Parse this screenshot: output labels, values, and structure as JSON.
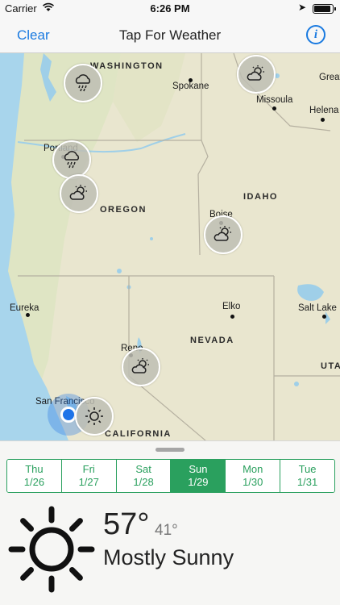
{
  "status_bar": {
    "carrier": "Carrier",
    "time": "6:26 PM"
  },
  "nav": {
    "clear_label": "Clear",
    "title": "Tap For Weather",
    "info_label": "i"
  },
  "map": {
    "cities": [
      "Spokane",
      "Missoula",
      "Helena",
      "Great",
      "Portland",
      "Boise",
      "Eureka",
      "Elko",
      "Salt Lake",
      "Reno",
      "San Francisco"
    ],
    "states": [
      "WASHINGTON",
      "OREGON",
      "IDAHO",
      "NEVADA",
      "CALIFORNIA",
      "UTA"
    ],
    "pins": [
      {
        "place": "Washington",
        "icon": "rain-cloud-icon"
      },
      {
        "place": "Montana",
        "icon": "partly-cloudy-icon"
      },
      {
        "place": "Portland",
        "icon": "rain-cloud-icon"
      },
      {
        "place": "Oregon",
        "icon": "partly-cloudy-icon"
      },
      {
        "place": "Boise",
        "icon": "partly-cloudy-icon"
      },
      {
        "place": "Reno",
        "icon": "partly-cloudy-icon"
      },
      {
        "place": "San Francisco",
        "icon": "sun-icon"
      }
    ],
    "colors": {
      "land": "#ebe8d3",
      "water": "#9fcfe8",
      "ocean": "#a8d5ec",
      "border": "#b5b0a0"
    }
  },
  "forecast": {
    "days": [
      {
        "name": "Thu",
        "date": "1/26"
      },
      {
        "name": "Fri",
        "date": "1/27"
      },
      {
        "name": "Sat",
        "date": "1/28"
      },
      {
        "name": "Sun",
        "date": "1/29"
      },
      {
        "name": "Mon",
        "date": "1/30"
      },
      {
        "name": "Tue",
        "date": "1/31"
      }
    ],
    "selected_day": "Sun",
    "high": "57°",
    "low": "41°",
    "condition": "Mostly Sunny",
    "condition_icon": "sun-icon",
    "accent_color": "#2aa05e"
  }
}
